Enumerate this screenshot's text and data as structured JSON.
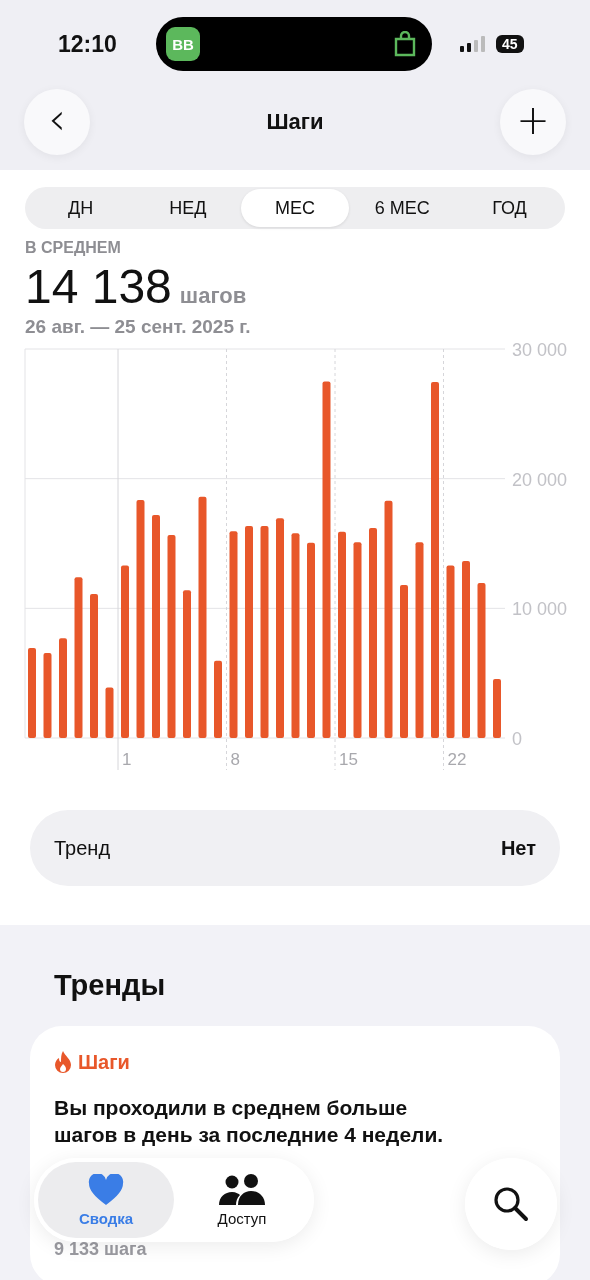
{
  "status_bar": {
    "time": "12:10",
    "island_app": "BB",
    "battery": "45"
  },
  "nav": {
    "back": "‹",
    "title": "Шаги",
    "add": "+"
  },
  "ranges": [
    {
      "label": "ДН",
      "selected": false
    },
    {
      "label": "НЕД",
      "selected": false
    },
    {
      "label": "МЕС",
      "selected": true
    },
    {
      "label": "6 МЕС",
      "selected": false
    },
    {
      "label": "ГОД",
      "selected": false
    }
  ],
  "summary": {
    "caption": "В СРЕДНЕМ",
    "value": "14 138",
    "unit": "шагов",
    "period": "26 авг. — 25 сент. 2025 г."
  },
  "chart_data": {
    "type": "bar",
    "categories": [
      null,
      null,
      null,
      null,
      null,
      null,
      "1",
      null,
      null,
      null,
      null,
      null,
      null,
      "8",
      null,
      null,
      null,
      null,
      null,
      null,
      "15",
      null,
      null,
      null,
      null,
      null,
      null,
      "22",
      null,
      null,
      null
    ],
    "series": [
      {
        "color": "#e8572a",
        "values": [
          6950,
          6550,
          7700,
          12400,
          11100,
          3900,
          13300,
          18350,
          17200,
          15650,
          11400,
          18600,
          5950,
          15950,
          16350,
          16350,
          16950,
          15800,
          15050,
          27500,
          15900,
          15100,
          16200,
          18300,
          11800,
          15100,
          27450,
          13300,
          13650,
          11950,
          4550
        ]
      }
    ],
    "grid": true,
    "ylim": [
      0,
      30000
    ],
    "yticks": [
      {
        "value": 0,
        "label": "0"
      },
      {
        "value": 10000,
        "label": "10 000"
      },
      {
        "value": 20000,
        "label": "20 000"
      },
      {
        "value": 30000,
        "label": "30 000"
      }
    ]
  },
  "trend_row": {
    "label": "Тренд",
    "value": "Нет"
  },
  "trends": {
    "title": "Тренды",
    "card": {
      "category": "Шаги",
      "text": "Вы проходили в среднем больше шагов в день за последние 4 недели.",
      "faded_value": "9 133 шага"
    }
  },
  "tab_bar": [
    {
      "label": "Сводка",
      "kind": "heart",
      "selected": true
    },
    {
      "label": "Доступ",
      "kind": "people",
      "selected": false
    }
  ]
}
